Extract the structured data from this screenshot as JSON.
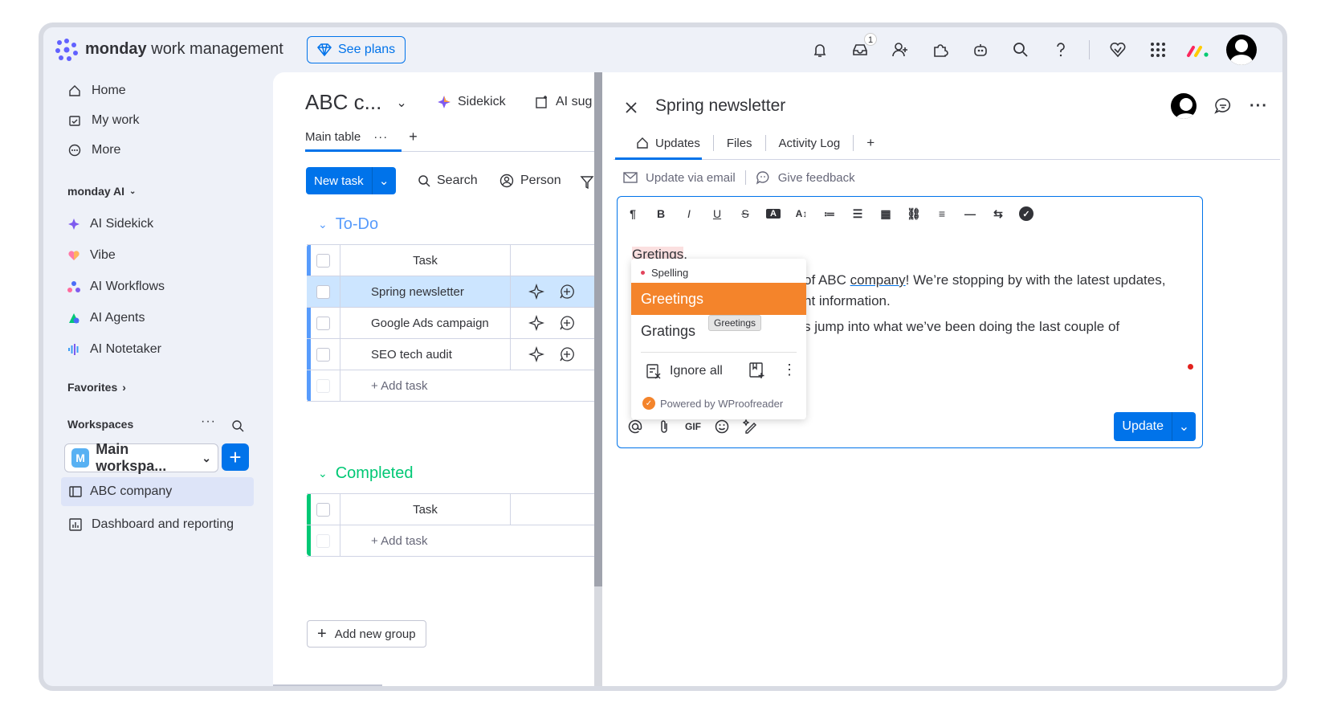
{
  "topbar": {
    "brand_bold": "monday",
    "brand_rest": " work management",
    "see_plans": "See plans",
    "inbox_badge": "1"
  },
  "sidebar": {
    "items": [
      {
        "label": "Home",
        "icon": "home-icon"
      },
      {
        "label": "My work",
        "icon": "calendar-check-icon"
      },
      {
        "label": "More",
        "icon": "more-circle-icon"
      }
    ],
    "ai_section": "monday AI",
    "ai_items": [
      {
        "label": "AI Sidekick",
        "icon": "sidekick-icon",
        "color": "#7e5bef"
      },
      {
        "label": "Vibe",
        "icon": "vibe-heart-icon",
        "color": "#ff6b9d"
      },
      {
        "label": "AI Workflows",
        "icon": "workflows-icon",
        "color": "#4a6cf7"
      },
      {
        "label": "AI Agents",
        "icon": "agents-icon",
        "color": "#00c875"
      },
      {
        "label": "AI Notetaker",
        "icon": "notetaker-icon",
        "color": "#3d9cf5"
      }
    ],
    "favorites": "Favorites",
    "workspaces": "Workspaces",
    "workspace_name": "Main workspa...",
    "workspace_initial": "M",
    "boards": [
      {
        "label": "ABC company",
        "icon": "board-icon"
      },
      {
        "label": "Dashboard and reporting",
        "icon": "dashboard-icon"
      }
    ]
  },
  "board": {
    "title": "ABC c...",
    "sidekick": "Sidekick",
    "ai_sug": "AI sug",
    "main_table": "Main table",
    "new_task": "New task",
    "search": "Search",
    "person": "Person",
    "groups": [
      {
        "name": "To-Do",
        "color": "#579bfc",
        "header": "Task",
        "rows": [
          "Spring newsletter",
          "Google Ads campaign",
          "SEO tech audit"
        ],
        "add": "+ Add task"
      },
      {
        "name": "Completed",
        "color": "#00c875",
        "header": "Task",
        "rows": [],
        "add": "+ Add task"
      }
    ],
    "add_group": "Add new group"
  },
  "panel": {
    "title": "Spring newsletter",
    "tabs": [
      "Updates",
      "Files",
      "Activity Log",
      "+"
    ],
    "update_via_email": "Update via email",
    "give_feedback": "Give feedback",
    "toolbar": [
      "¶",
      "B",
      "I",
      "U",
      "S",
      "A",
      "A↕",
      "≔",
      "☰",
      "▦",
      "⛓",
      "≡",
      "—",
      "⇆"
    ],
    "text": {
      "greeting": "Gretings",
      "comma": ",",
      "line1_pre": "of ABC ",
      "line1_link": "company",
      "line1_post": "! We’re stopping by with the latest updates,",
      "line2": "nt information.",
      "line3": "s jump into what we’ve been doing the last couple of"
    },
    "update_button": "Update",
    "gif": "GIF"
  },
  "spell_popup": {
    "header": "Spelling",
    "selected": "Greetings",
    "alternative": "Gratings",
    "tooltip": "Greetings",
    "ignore": "Ignore all",
    "powered": "Powered by WProofreader"
  }
}
